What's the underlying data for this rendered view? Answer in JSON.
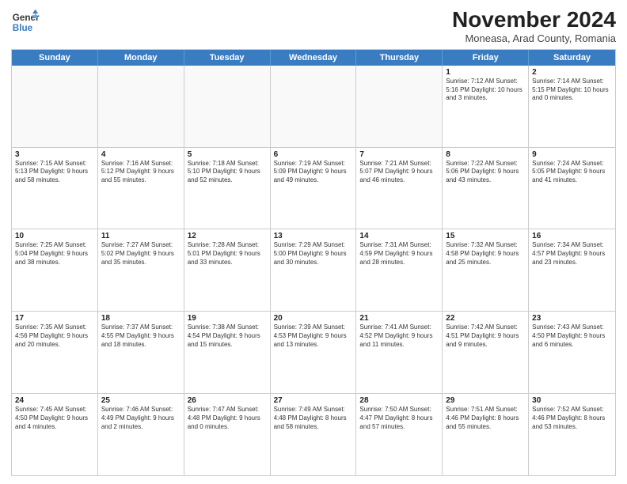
{
  "logo": {
    "line1": "General",
    "line2": "Blue"
  },
  "title": "November 2024",
  "subtitle": "Moneasa, Arad County, Romania",
  "header_days": [
    "Sunday",
    "Monday",
    "Tuesday",
    "Wednesday",
    "Thursday",
    "Friday",
    "Saturday"
  ],
  "weeks": [
    [
      {
        "day": "",
        "info": "",
        "shaded": true
      },
      {
        "day": "",
        "info": "",
        "shaded": true
      },
      {
        "day": "",
        "info": "",
        "shaded": true
      },
      {
        "day": "",
        "info": "",
        "shaded": true
      },
      {
        "day": "",
        "info": "",
        "shaded": true
      },
      {
        "day": "1",
        "info": "Sunrise: 7:12 AM\nSunset: 5:16 PM\nDaylight: 10 hours\nand 3 minutes.",
        "shaded": false
      },
      {
        "day": "2",
        "info": "Sunrise: 7:14 AM\nSunset: 5:15 PM\nDaylight: 10 hours\nand 0 minutes.",
        "shaded": false
      }
    ],
    [
      {
        "day": "3",
        "info": "Sunrise: 7:15 AM\nSunset: 5:13 PM\nDaylight: 9 hours\nand 58 minutes.",
        "shaded": false
      },
      {
        "day": "4",
        "info": "Sunrise: 7:16 AM\nSunset: 5:12 PM\nDaylight: 9 hours\nand 55 minutes.",
        "shaded": false
      },
      {
        "day": "5",
        "info": "Sunrise: 7:18 AM\nSunset: 5:10 PM\nDaylight: 9 hours\nand 52 minutes.",
        "shaded": false
      },
      {
        "day": "6",
        "info": "Sunrise: 7:19 AM\nSunset: 5:09 PM\nDaylight: 9 hours\nand 49 minutes.",
        "shaded": false
      },
      {
        "day": "7",
        "info": "Sunrise: 7:21 AM\nSunset: 5:07 PM\nDaylight: 9 hours\nand 46 minutes.",
        "shaded": false
      },
      {
        "day": "8",
        "info": "Sunrise: 7:22 AM\nSunset: 5:06 PM\nDaylight: 9 hours\nand 43 minutes.",
        "shaded": false
      },
      {
        "day": "9",
        "info": "Sunrise: 7:24 AM\nSunset: 5:05 PM\nDaylight: 9 hours\nand 41 minutes.",
        "shaded": false
      }
    ],
    [
      {
        "day": "10",
        "info": "Sunrise: 7:25 AM\nSunset: 5:04 PM\nDaylight: 9 hours\nand 38 minutes.",
        "shaded": false
      },
      {
        "day": "11",
        "info": "Sunrise: 7:27 AM\nSunset: 5:02 PM\nDaylight: 9 hours\nand 35 minutes.",
        "shaded": false
      },
      {
        "day": "12",
        "info": "Sunrise: 7:28 AM\nSunset: 5:01 PM\nDaylight: 9 hours\nand 33 minutes.",
        "shaded": false
      },
      {
        "day": "13",
        "info": "Sunrise: 7:29 AM\nSunset: 5:00 PM\nDaylight: 9 hours\nand 30 minutes.",
        "shaded": false
      },
      {
        "day": "14",
        "info": "Sunrise: 7:31 AM\nSunset: 4:59 PM\nDaylight: 9 hours\nand 28 minutes.",
        "shaded": false
      },
      {
        "day": "15",
        "info": "Sunrise: 7:32 AM\nSunset: 4:58 PM\nDaylight: 9 hours\nand 25 minutes.",
        "shaded": false
      },
      {
        "day": "16",
        "info": "Sunrise: 7:34 AM\nSunset: 4:57 PM\nDaylight: 9 hours\nand 23 minutes.",
        "shaded": false
      }
    ],
    [
      {
        "day": "17",
        "info": "Sunrise: 7:35 AM\nSunset: 4:56 PM\nDaylight: 9 hours\nand 20 minutes.",
        "shaded": false
      },
      {
        "day": "18",
        "info": "Sunrise: 7:37 AM\nSunset: 4:55 PM\nDaylight: 9 hours\nand 18 minutes.",
        "shaded": false
      },
      {
        "day": "19",
        "info": "Sunrise: 7:38 AM\nSunset: 4:54 PM\nDaylight: 9 hours\nand 15 minutes.",
        "shaded": false
      },
      {
        "day": "20",
        "info": "Sunrise: 7:39 AM\nSunset: 4:53 PM\nDaylight: 9 hours\nand 13 minutes.",
        "shaded": false
      },
      {
        "day": "21",
        "info": "Sunrise: 7:41 AM\nSunset: 4:52 PM\nDaylight: 9 hours\nand 11 minutes.",
        "shaded": false
      },
      {
        "day": "22",
        "info": "Sunrise: 7:42 AM\nSunset: 4:51 PM\nDaylight: 9 hours\nand 9 minutes.",
        "shaded": false
      },
      {
        "day": "23",
        "info": "Sunrise: 7:43 AM\nSunset: 4:50 PM\nDaylight: 9 hours\nand 6 minutes.",
        "shaded": false
      }
    ],
    [
      {
        "day": "24",
        "info": "Sunrise: 7:45 AM\nSunset: 4:50 PM\nDaylight: 9 hours\nand 4 minutes.",
        "shaded": false
      },
      {
        "day": "25",
        "info": "Sunrise: 7:46 AM\nSunset: 4:49 PM\nDaylight: 9 hours\nand 2 minutes.",
        "shaded": false
      },
      {
        "day": "26",
        "info": "Sunrise: 7:47 AM\nSunset: 4:48 PM\nDaylight: 9 hours\nand 0 minutes.",
        "shaded": false
      },
      {
        "day": "27",
        "info": "Sunrise: 7:49 AM\nSunset: 4:48 PM\nDaylight: 8 hours\nand 58 minutes.",
        "shaded": false
      },
      {
        "day": "28",
        "info": "Sunrise: 7:50 AM\nSunset: 4:47 PM\nDaylight: 8 hours\nand 57 minutes.",
        "shaded": false
      },
      {
        "day": "29",
        "info": "Sunrise: 7:51 AM\nSunset: 4:46 PM\nDaylight: 8 hours\nand 55 minutes.",
        "shaded": false
      },
      {
        "day": "30",
        "info": "Sunrise: 7:52 AM\nSunset: 4:46 PM\nDaylight: 8 hours\nand 53 minutes.",
        "shaded": false
      }
    ]
  ]
}
